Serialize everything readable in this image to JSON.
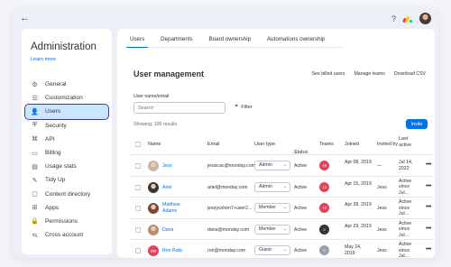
{
  "topbar": {
    "back_icon": "arrow-left-icon",
    "help": "?",
    "apps_icon": "monday-apps-icon"
  },
  "sidebar": {
    "title": "Administration",
    "learn_more": "Learn more",
    "items": [
      {
        "label": "General",
        "icon": "gear-icon",
        "glyph": "⚙"
      },
      {
        "label": "Customization",
        "icon": "sliders-icon",
        "glyph": "☰"
      },
      {
        "label": "Users",
        "icon": "users-icon",
        "glyph": "👤",
        "active": true
      },
      {
        "label": "Security",
        "icon": "shield-icon",
        "glyph": "⛨"
      },
      {
        "label": "API",
        "icon": "api-icon",
        "glyph": "⌘"
      },
      {
        "label": "Billing",
        "icon": "card-icon",
        "glyph": "▭"
      },
      {
        "label": "Usage stats",
        "icon": "chart-icon",
        "glyph": "▤"
      },
      {
        "label": "Tidy Up",
        "icon": "broom-icon",
        "glyph": "✎"
      },
      {
        "label": "Content directory",
        "icon": "folder-icon",
        "glyph": "▢"
      },
      {
        "label": "Apps",
        "icon": "apps-icon",
        "glyph": "⊞"
      },
      {
        "label": "Permissions",
        "icon": "lock-icon",
        "glyph": "🔒"
      },
      {
        "label": "Cross account",
        "icon": "arrows-icon",
        "glyph": "⇆"
      }
    ]
  },
  "tabs": [
    "Users",
    "Departments",
    "Board ownership",
    "Automations ownership"
  ],
  "page_title": "User management",
  "actions": [
    "See billed users",
    "Manage teams",
    "Download CSV"
  ],
  "search": {
    "label": "User name/email",
    "placeholder": "Search"
  },
  "filter_label": "Filter",
  "showing": "Showing: 105 results",
  "invite_label": "Invite",
  "columns": {
    "name": "Name",
    "email": "Email",
    "user_type": "User type",
    "status": "Status",
    "teams": "Teams",
    "joined": "Joined",
    "invited_by": "Invited by",
    "last_active": "Last active"
  },
  "rows": [
    {
      "name": "Jess",
      "email": "jessicac@monday.com",
      "user_type": "Admin",
      "status": "Active",
      "team": "+8",
      "joined": "Apr 08, 2019",
      "invited_by": "—",
      "last_active": "Jul 14, 2022",
      "avatar_color": "#c9b7a6",
      "team_color": "#e2445c"
    },
    {
      "name": "Ariel",
      "email": "ariel@monday.com",
      "user_type": "Admin",
      "status": "Active",
      "team": "+2",
      "joined": "Apr 15, 2019",
      "invited_by": "Jess",
      "last_active": "Active since Jul...",
      "avatar_color": "#3d3533",
      "team_color": "#e2445c"
    },
    {
      "name": "Matthew Adams",
      "email": "jessycohen7+user2...",
      "user_type": "Member",
      "status": "Active",
      "team": "+3",
      "joined": "Apr 28, 2019",
      "invited_by": "Jess",
      "last_active": "Active since Jul...",
      "avatar_color": "#7a4b3a",
      "team_color": "#e2445c"
    },
    {
      "name": "Dana",
      "email": "dana@monday.com",
      "user_type": "Member",
      "status": "Active",
      "team": "",
      "joined": "Apr 29, 2019",
      "invited_by": "Jess",
      "last_active": "Active since Jul...",
      "avatar_color": "#b98c6e",
      "team_color": "#323338"
    },
    {
      "name": "Ron Rafa",
      "email": "ron@monday.com",
      "user_type": "Guest",
      "status": "Active",
      "team": "",
      "joined": "May 24, 2019",
      "invited_by": "Jess",
      "last_active": "Active since Jul...",
      "avatar_color": "#e2445c",
      "avatar_initials": "RR",
      "team_color": "#9aa0ab"
    }
  ]
}
